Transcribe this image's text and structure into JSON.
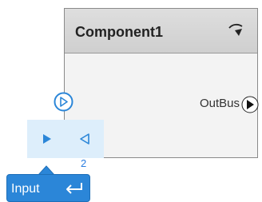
{
  "component": {
    "title": "Component1",
    "output_port_label": "OutBus",
    "header_icon": "curved-arrow-icon"
  },
  "input_port": {
    "number": "2",
    "tooltip_label": "Input",
    "tooltip_icon": "enter-icon"
  },
  "colors": {
    "accent": "#2b86d8",
    "header_bg": "#d6d6d6",
    "block_bg": "#f3f3f3",
    "connection_zone": "#ddeefb"
  }
}
